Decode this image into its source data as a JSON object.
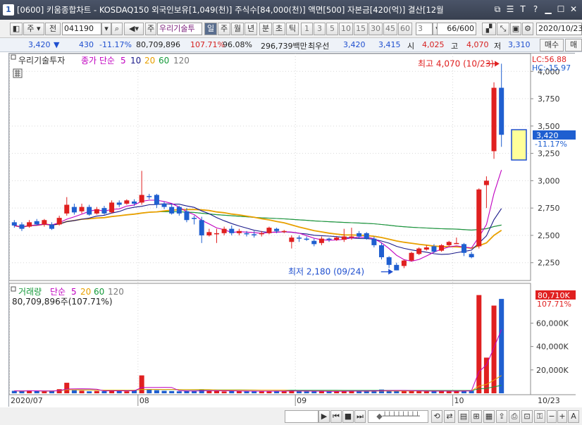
{
  "titlebar": {
    "num": "1",
    "title": "[0600] 키움종합차트 - KOSDAQ150 외국인보유[1,049(천)] 주식수[84,000(천)] 액면[500] 자본금[420(억)] 결산[12월"
  },
  "toolbar": {
    "code": "041190",
    "stock_name": "우리기술투",
    "period_buttons": [
      "일",
      "주",
      "월",
      "년",
      "분",
      "초",
      "틱"
    ],
    "interval_buttons": [
      "1",
      "3",
      "5",
      "10",
      "15",
      "30",
      "45",
      "60"
    ],
    "interval_value": "3",
    "count": "66/600",
    "date": "2020/10/23",
    "side_labels": [
      "주",
      "전"
    ]
  },
  "quote": {
    "price": "3,420",
    "change": "430",
    "change_pct": "-11.17%",
    "volume": "80,709,896",
    "volume_pct": "107.71%",
    "ratio": "96.08%",
    "amount": "296,739백만",
    "pref_label": "최우선",
    "bid": "3,420",
    "ask": "3,415",
    "open_label": "시",
    "open": "4,025",
    "high_label": "고",
    "high": "4,070",
    "low_label": "저",
    "low": "3,310",
    "buy_label": "매수",
    "sell_label": "매"
  },
  "price_panel": {
    "name": "우리기술투자",
    "ma_label": "종가 단순",
    "ma_periods": [
      "5",
      "10",
      "20",
      "60",
      "120"
    ],
    "lc": "LC:56.88",
    "hc": "HC:-15.97",
    "high_note": "최고 4,070 (10/23)",
    "low_note": "최저 2,180 (09/24)",
    "current_price_tag": "3,420",
    "current_change_tag": "-11.17%",
    "yaxis_labels": [
      "4,000",
      "3,750",
      "3,500",
      "3,250",
      "3,000",
      "2,750",
      "2,500",
      "2,250"
    ]
  },
  "volume_panel": {
    "name": "거래량",
    "ma_label": "단순",
    "ma_periods": [
      "5",
      "20",
      "60",
      "120"
    ],
    "volume_text": "80,709,896주(107.71%)",
    "current_tag": "80,710K",
    "current_pct": "107.71%",
    "yaxis_labels": [
      "60,000K",
      "40,000K",
      "20,000K"
    ]
  },
  "xaxis_labels": [
    "2020/07",
    "08",
    "09",
    "10",
    "10/23"
  ],
  "colors": {
    "up": "#e02020",
    "down": "#1f5fd0",
    "ma5": "#c000c0",
    "ma10": "#1a1a8a",
    "ma20": "#e8a000",
    "ma60": "#159a3a",
    "ma120": "#7a7a7a"
  },
  "chart_data": {
    "type": "candlestick",
    "ylim": [
      2100,
      4150
    ],
    "candles": [
      {
        "o": 2620,
        "c": 2590,
        "h": 2640,
        "l": 2570
      },
      {
        "o": 2600,
        "c": 2560,
        "h": 2620,
        "l": 2540
      },
      {
        "o": 2580,
        "c": 2620,
        "h": 2640,
        "l": 2570
      },
      {
        "o": 2630,
        "c": 2600,
        "h": 2650,
        "l": 2590
      },
      {
        "o": 2600,
        "c": 2640,
        "h": 2650,
        "l": 2580
      },
      {
        "o": 2600,
        "c": 2560,
        "h": 2620,
        "l": 2550
      },
      {
        "o": 2600,
        "c": 2660,
        "h": 2680,
        "l": 2590
      },
      {
        "o": 2700,
        "c": 2780,
        "h": 2850,
        "l": 2680
      },
      {
        "o": 2760,
        "c": 2710,
        "h": 2790,
        "l": 2690
      },
      {
        "o": 2720,
        "c": 2760,
        "h": 2790,
        "l": 2700
      },
      {
        "o": 2760,
        "c": 2690,
        "h": 2780,
        "l": 2680
      },
      {
        "o": 2700,
        "c": 2740,
        "h": 2760,
        "l": 2690
      },
      {
        "o": 2750,
        "c": 2700,
        "h": 2770,
        "l": 2690
      },
      {
        "o": 2710,
        "c": 2800,
        "h": 2820,
        "l": 2700
      },
      {
        "o": 2800,
        "c": 2780,
        "h": 2820,
        "l": 2760
      },
      {
        "o": 2790,
        "c": 2820,
        "h": 2830,
        "l": 2780
      },
      {
        "o": 2810,
        "c": 2790,
        "h": 2830,
        "l": 2770
      },
      {
        "o": 2800,
        "c": 2870,
        "h": 3090,
        "l": 2780
      },
      {
        "o": 2860,
        "c": 2850,
        "h": 2880,
        "l": 2830
      },
      {
        "o": 2870,
        "c": 2780,
        "h": 2880,
        "l": 2750
      },
      {
        "o": 2790,
        "c": 2760,
        "h": 2810,
        "l": 2740
      },
      {
        "o": 2760,
        "c": 2700,
        "h": 2790,
        "l": 2690
      },
      {
        "o": 2760,
        "c": 2700,
        "h": 2770,
        "l": 2680
      },
      {
        "o": 2720,
        "c": 2640,
        "h": 2750,
        "l": 2620
      },
      {
        "o": 2660,
        "c": 2650,
        "h": 2680,
        "l": 2600
      },
      {
        "o": 2640,
        "c": 2500,
        "h": 2670,
        "l": 2430
      },
      {
        "o": 2500,
        "c": 2530,
        "h": 2560,
        "l": 2490
      },
      {
        "o": 2510,
        "c": 2520,
        "h": 2560,
        "l": 2430
      },
      {
        "o": 2520,
        "c": 2560,
        "h": 2580,
        "l": 2500
      },
      {
        "o": 2560,
        "c": 2520,
        "h": 2590,
        "l": 2500
      },
      {
        "o": 2520,
        "c": 2540,
        "h": 2560,
        "l": 2500
      },
      {
        "o": 2520,
        "c": 2510,
        "h": 2540,
        "l": 2490
      },
      {
        "o": 2510,
        "c": 2500,
        "h": 2540,
        "l": 2480
      },
      {
        "o": 2510,
        "c": 2520,
        "h": 2540,
        "l": 2490
      },
      {
        "o": 2520,
        "c": 2570,
        "h": 2580,
        "l": 2510
      },
      {
        "o": 2560,
        "c": 2540,
        "h": 2570,
        "l": 2520
      },
      {
        "o": 2540,
        "c": 2540,
        "h": 2550,
        "l": 2520
      },
      {
        "o": 2440,
        "c": 2480,
        "h": 2500,
        "l": 2380
      },
      {
        "o": 2480,
        "c": 2470,
        "h": 2500,
        "l": 2440
      },
      {
        "o": 2470,
        "c": 2460,
        "h": 2490,
        "l": 2450
      },
      {
        "o": 2450,
        "c": 2420,
        "h": 2470,
        "l": 2400
      },
      {
        "o": 2430,
        "c": 2470,
        "h": 2490,
        "l": 2410
      },
      {
        "o": 2470,
        "c": 2460,
        "h": 2480,
        "l": 2440
      },
      {
        "o": 2460,
        "c": 2480,
        "h": 2490,
        "l": 2450
      },
      {
        "o": 2460,
        "c": 2490,
        "h": 2560,
        "l": 2440
      },
      {
        "o": 2480,
        "c": 2490,
        "h": 2570,
        "l": 2460
      },
      {
        "o": 2520,
        "c": 2490,
        "h": 2540,
        "l": 2470
      },
      {
        "o": 2520,
        "c": 2470,
        "h": 2530,
        "l": 2460
      },
      {
        "o": 2470,
        "c": 2410,
        "h": 2490,
        "l": 2390
      },
      {
        "o": 2410,
        "c": 2300,
        "h": 2430,
        "l": 2280
      },
      {
        "o": 2300,
        "c": 2230,
        "h": 2310,
        "l": 2200
      },
      {
        "o": 2230,
        "c": 2180,
        "h": 2250,
        "l": 2180
      },
      {
        "o": 2220,
        "c": 2270,
        "h": 2280,
        "l": 2200
      },
      {
        "o": 2270,
        "c": 2340,
        "h": 2350,
        "l": 2260
      },
      {
        "o": 2330,
        "c": 2380,
        "h": 2390,
        "l": 2320
      },
      {
        "o": 2370,
        "c": 2390,
        "h": 2410,
        "l": 2360
      },
      {
        "o": 2400,
        "c": 2350,
        "h": 2420,
        "l": 2340
      },
      {
        "o": 2360,
        "c": 2410,
        "h": 2420,
        "l": 2350
      },
      {
        "o": 2410,
        "c": 2440,
        "h": 2450,
        "l": 2400
      },
      {
        "o": 2430,
        "c": 2430,
        "h": 2480,
        "l": 2420
      },
      {
        "o": 2420,
        "c": 2340,
        "h": 2430,
        "l": 2310
      },
      {
        "o": 2330,
        "c": 2300,
        "h": 2350,
        "l": 2290
      },
      {
        "o": 2400,
        "c": 2920,
        "h": 2930,
        "l": 2380
      },
      {
        "o": 2960,
        "c": 3000,
        "h": 3040,
        "l": 2750
      },
      {
        "o": 3270,
        "c": 3850,
        "h": 3900,
        "l": 3200
      },
      {
        "o": 3850,
        "c": 3420,
        "h": 4070,
        "l": 3310
      }
    ],
    "volumes": [
      2.1,
      1.8,
      2.5,
      2.0,
      1.6,
      1.9,
      3.5,
      9.0,
      2.6,
      2.2,
      1.7,
      2.0,
      1.8,
      2.8,
      2.2,
      1.7,
      2.4,
      15.3,
      3.0,
      2.6,
      2.1,
      1.9,
      1.7,
      2.0,
      1.8,
      3.0,
      2.2,
      2.0,
      1.6,
      1.8,
      2.1,
      1.7,
      1.9,
      1.6,
      1.8,
      2.0,
      1.7,
      2.4,
      1.9,
      1.6,
      1.5,
      1.7,
      1.6,
      1.8,
      2.0,
      2.1,
      1.7,
      1.9,
      2.5,
      3.2,
      2.6,
      2.0,
      1.9,
      1.8,
      2.1,
      1.6,
      1.8,
      2.0,
      1.7,
      1.9,
      2.6,
      2.3,
      84.0,
      30.5,
      75.0,
      80.7
    ],
    "volume_ylim": [
      0,
      88
    ],
    "volume_unit": "백만주"
  }
}
